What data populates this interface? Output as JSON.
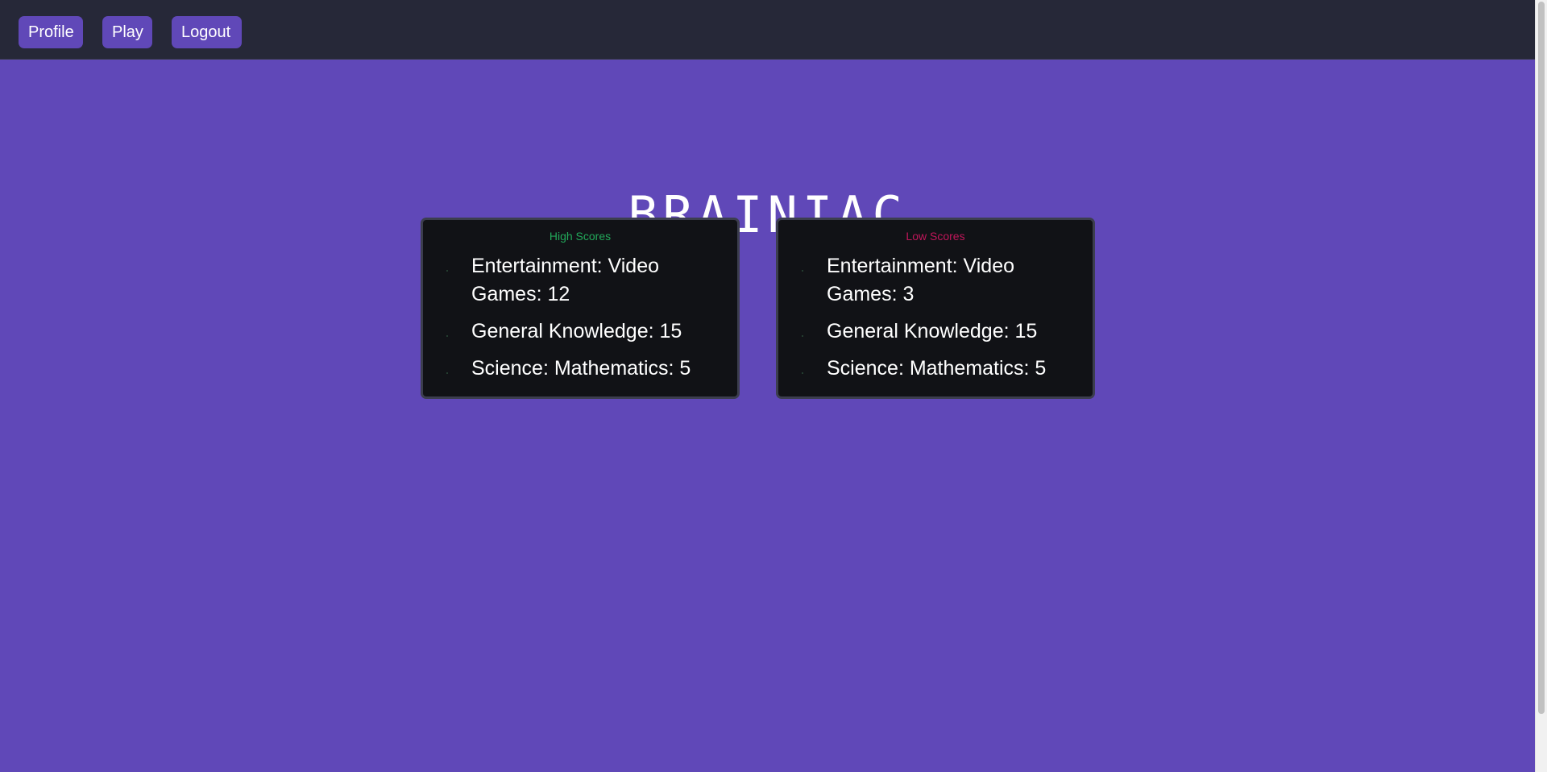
{
  "nav": {
    "profile_label": "Profile",
    "play_label": "Play",
    "logout_label": "Logout"
  },
  "title": "BRAINIAC",
  "high_scores": {
    "heading": "High Scores",
    "items": [
      "Entertainment: Video Games: 12",
      "General Knowledge: 15",
      "Science: Mathematics: 5"
    ]
  },
  "low_scores": {
    "heading": "Low Scores",
    "items": [
      "Entertainment: Video Games: 3",
      "General Knowledge: 15",
      "Science: Mathematics: 5"
    ]
  },
  "colors": {
    "background": "#6048b8",
    "navbar": "#262838",
    "card": "#111216",
    "high_heading": "#22a85a",
    "low_heading": "#c0165a"
  }
}
